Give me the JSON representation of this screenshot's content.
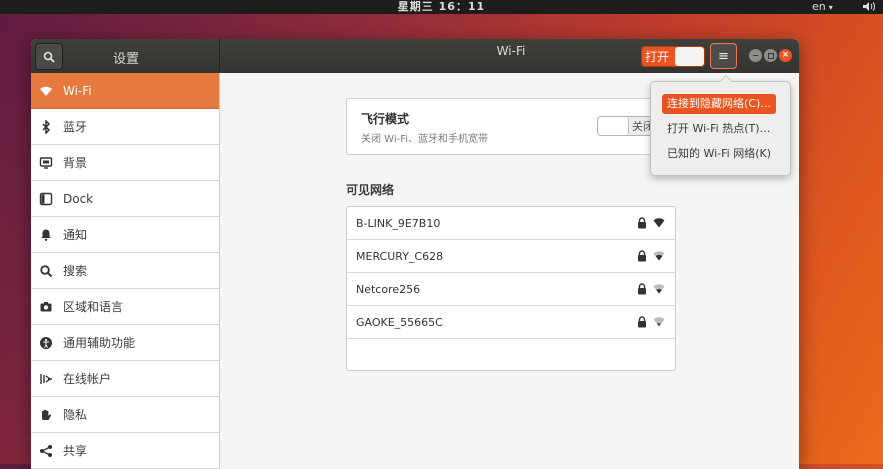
{
  "topbar": {
    "clock": "星期三 16：11",
    "lang": "en",
    "lang_arrow": "▾"
  },
  "window": {
    "sidebar_title": "设置",
    "title": "Wi-Fi",
    "wifi_switch_label": "打开",
    "close_glyph": "×",
    "menu_glyph": "≡"
  },
  "sidebar": {
    "items": [
      {
        "label": "Wi-Fi",
        "icon": "wifi-icon"
      },
      {
        "label": "蓝牙",
        "icon": "bluetooth-icon"
      },
      {
        "label": "背景",
        "icon": "background-icon"
      },
      {
        "label": "Dock",
        "icon": "dock-icon"
      },
      {
        "label": "通知",
        "icon": "bell-icon"
      },
      {
        "label": "搜索",
        "icon": "search-icon"
      },
      {
        "label": "区域和语言",
        "icon": "camera-icon"
      },
      {
        "label": "通用辅助功能",
        "icon": "accessibility-icon"
      },
      {
        "label": "在线帐户",
        "icon": "online-accounts-icon"
      },
      {
        "label": "隐私",
        "icon": "hand-icon"
      },
      {
        "label": "共享",
        "icon": "share-icon"
      }
    ]
  },
  "airplane": {
    "title": "飞行模式",
    "subtitle": "关闭 Wi-Fi、蓝牙和手机宽带",
    "switch_label": "关闭"
  },
  "networks": {
    "heading": "可见网络",
    "list": [
      {
        "ssid": "B-LINK_9E7B10",
        "secured": true
      },
      {
        "ssid": "MERCURY_C628",
        "secured": true
      },
      {
        "ssid": "Netcore256",
        "secured": true
      },
      {
        "ssid": "GAOKE_55665C",
        "secured": true
      }
    ]
  },
  "menu": {
    "items": [
      {
        "label": "连接到隐藏网络(C)…"
      },
      {
        "label": "打开 Wi-Fi 热点(T)…"
      },
      {
        "label": "已知的 Wi-Fi 网络(K)"
      }
    ]
  },
  "colors": {
    "accent": "#e95420",
    "sidebar_active": "#e5793e",
    "headerbar": "#393937"
  }
}
